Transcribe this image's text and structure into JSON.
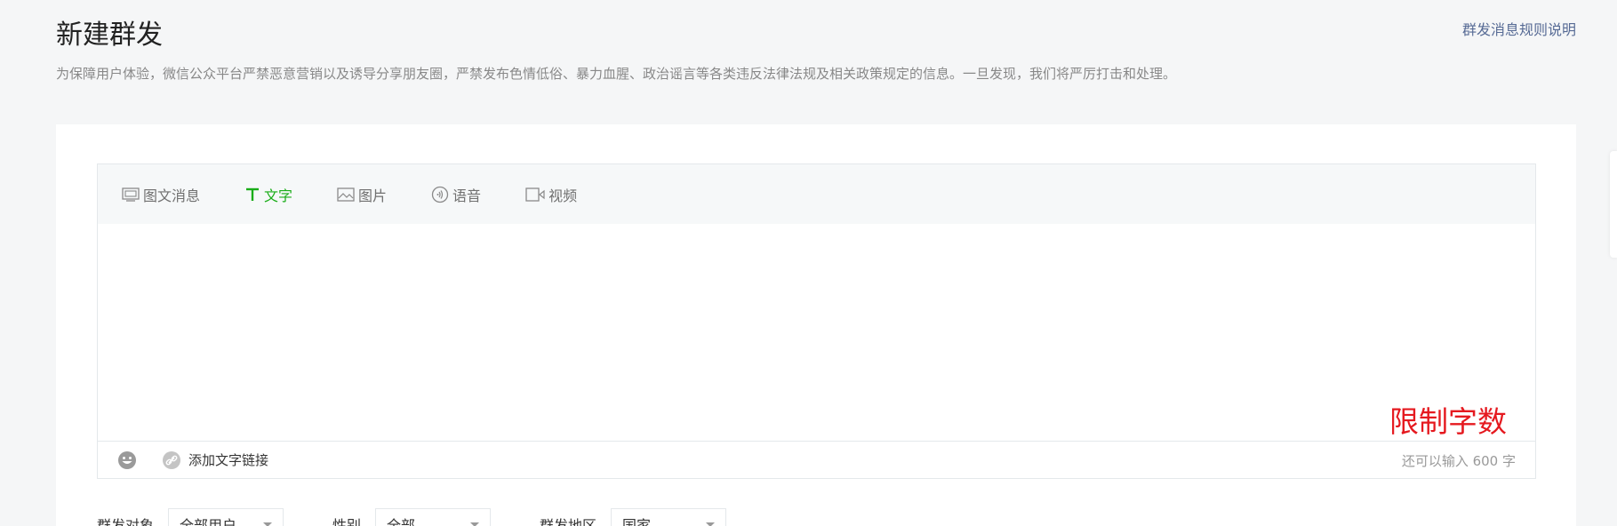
{
  "header": {
    "title": "新建群发",
    "rules_link": "群发消息规则说明",
    "notice": "为保障用户体验，微信公众平台严禁恶意营销以及诱导分享朋友圈，严禁发布色情低俗、暴力血腥、政治谣言等各类违反法律法规及相关政策规定的信息。一旦发现，我们将严厉打击和处理。"
  },
  "editor": {
    "tabs": [
      {
        "label": "图文消息",
        "icon": "news-icon"
      },
      {
        "label": "文字",
        "icon": "text-icon",
        "active": true
      },
      {
        "label": "图片",
        "icon": "image-icon"
      },
      {
        "label": "语音",
        "icon": "voice-icon"
      },
      {
        "label": "视频",
        "icon": "video-icon"
      }
    ],
    "limit_annotation": "限制字数",
    "add_link": "添加文字链接",
    "remaining": "还可以输入 600 字"
  },
  "filters": {
    "target_label": "群发对象",
    "target_value": "全部用户",
    "gender_label": "性别",
    "gender_value": "全部",
    "region_label": "群发地区",
    "region_value": "国家"
  },
  "colors": {
    "accent_green": "#1aad19",
    "link_blue": "#576b95",
    "annotation_red": "#e5191f"
  }
}
